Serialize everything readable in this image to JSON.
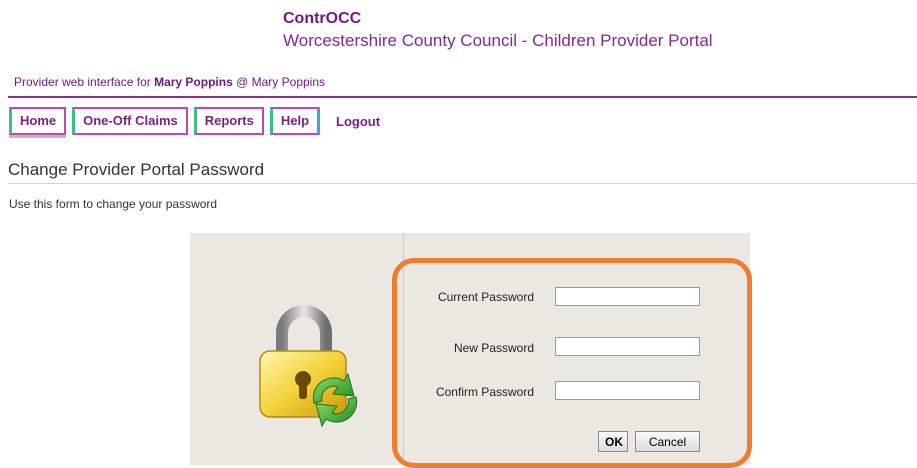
{
  "header": {
    "app_name": "ContrOCC",
    "org_name": "Worcestershire County Council - Children Provider Portal"
  },
  "subheader": {
    "prefix": "Provider web interface for",
    "user": "Mary Poppins",
    "separator": "@",
    "provider": "Mary Poppins"
  },
  "nav": {
    "tabs": [
      "Home",
      "One-Off Claims",
      "Reports",
      "Help"
    ],
    "logout": "Logout"
  },
  "page": {
    "title": "Change Provider Portal Password",
    "intro": "Use this form to change your password"
  },
  "form": {
    "current_label": "Current Password",
    "current_value": "",
    "new_label": "New Password",
    "new_value": "",
    "confirm_label": "Confirm Password",
    "confirm_value": "",
    "ok_label": "OK",
    "cancel_label": "Cancel"
  },
  "colors": {
    "brand_purple": "#6a1b7d",
    "highlight_orange": "#ed7d31",
    "panel_bg": "#ebe8e1"
  },
  "icons": {
    "lock": "padlock-refresh-icon"
  }
}
